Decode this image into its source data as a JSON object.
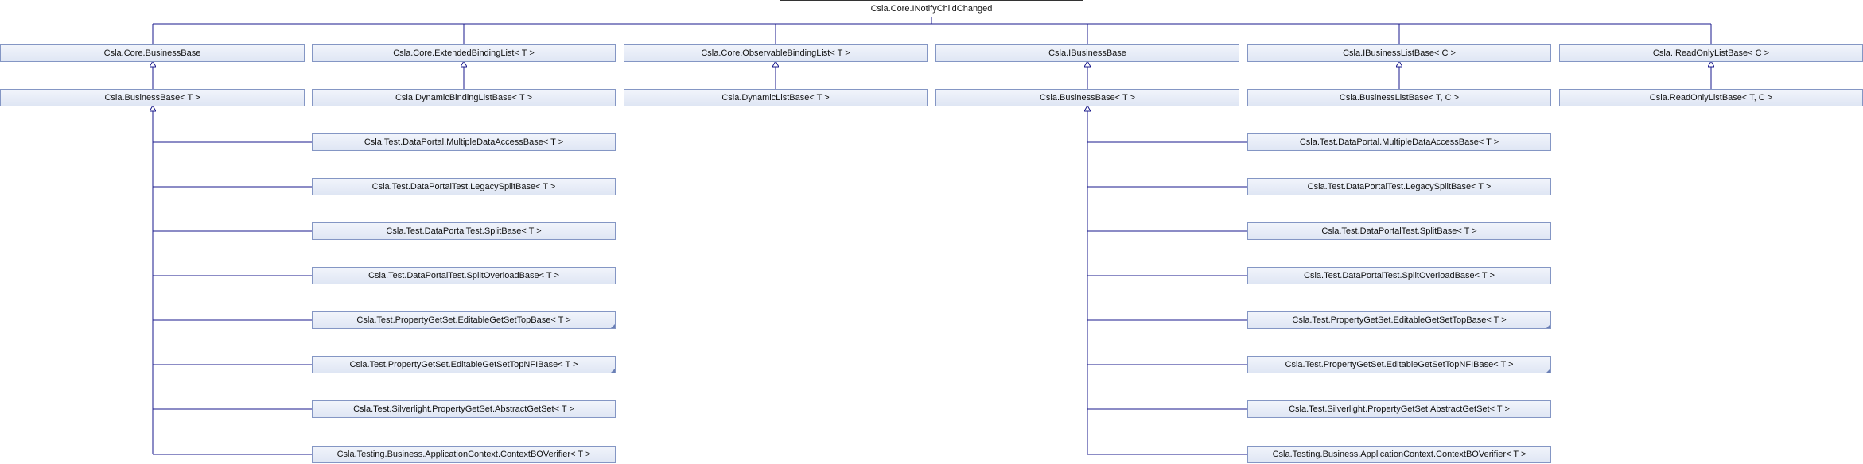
{
  "nodes": {
    "root": "Csla.Core.INotifyChildChanged",
    "core_business_base": "Csla.Core.BusinessBase",
    "extended_binding_list": "Csla.Core.ExtendedBindingList< T >",
    "observable_binding_list": "Csla.Core.ObservableBindingList< T >",
    "ibusiness_base": "Csla.IBusinessBase",
    "ibusiness_list_base": "Csla.IBusinessListBase< C >",
    "iread_only_list_base": "Csla.IReadOnlyListBase< C >",
    "business_base_left": "Csla.BusinessBase< T >",
    "dynamic_binding_list_base": "Csla.DynamicBindingListBase< T >",
    "dynamic_list_base": "Csla.DynamicListBase< T >",
    "business_base_right": "Csla.BusinessBase< T >",
    "business_list_base": "Csla.BusinessListBase< T, C >",
    "read_only_list_base": "Csla.ReadOnlyListBase< T, C >"
  },
  "derived_classes": [
    "Csla.Test.DataPortal.MultipleDataAccessBase< T >",
    "Csla.Test.DataPortalTest.LegacySplitBase< T >",
    "Csla.Test.DataPortalTest.SplitBase< T >",
    "Csla.Test.DataPortalTest.SplitOverloadBase< T >",
    "Csla.Test.PropertyGetSet.EditableGetSetTopBase< T >",
    "Csla.Test.PropertyGetSet.EditableGetSetTopNFIBase< T >",
    "Csla.Test.Silverlight.PropertyGetSet.AbstractGetSet< T >",
    "Csla.Testing.Business.ApplicationContext.ContextBOVerifier< T >"
  ],
  "colors": {
    "edge": "#1a1a8c",
    "node_border": "#8496c4",
    "node_fill": "#e3e9f6"
  }
}
